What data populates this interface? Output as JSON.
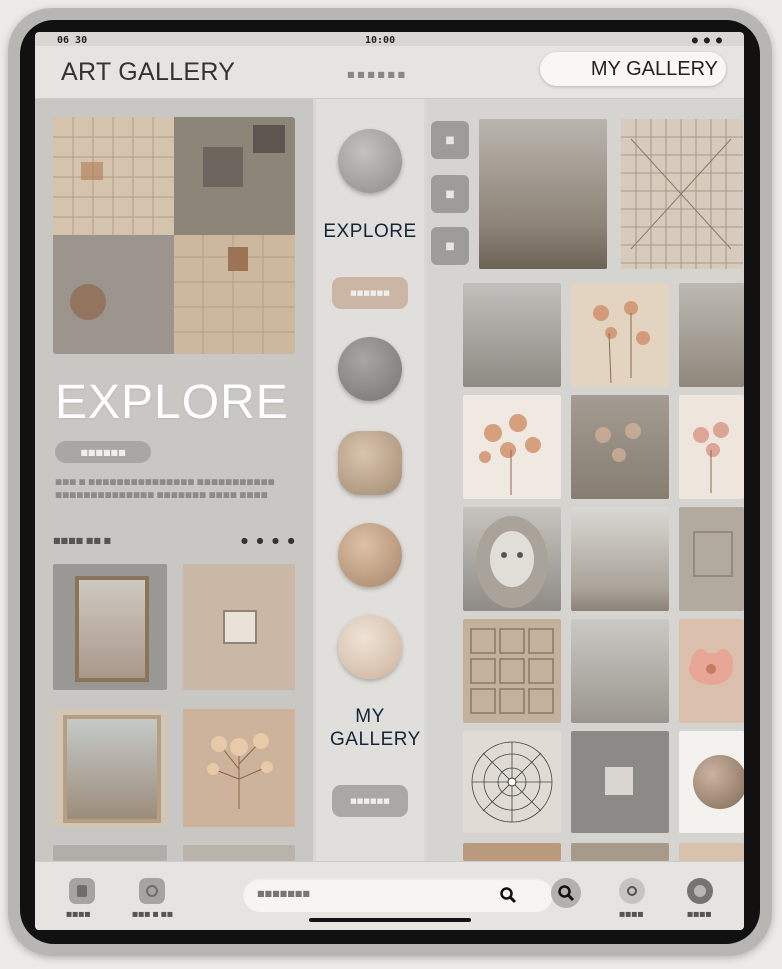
{
  "status": {
    "left": "06 30",
    "time": "10:00",
    "right": "● ● ●"
  },
  "header": {
    "title": "ART GALLERY",
    "center_text": "■ ■ ■   ■ ■ ■",
    "my_gallery_button": "MY GALLERY"
  },
  "left_panel": {
    "heading": "EXPLORE",
    "pill_label": "■■■■■■",
    "description": "■■■ ■ ■■■■■■■■■■■■■■■ ■■■■■■■■■■■ ■■■■■■■■■■■■■■ ■■■■■■■ ■■■■ ■■■■",
    "sub_label": "■■■■ ■■ ■",
    "dots": "● ● ● ●"
  },
  "center_column": {
    "explore_label": "EXPLORE",
    "my_gallery_label": "MY GALLERY",
    "pill_top": "■■■■■■",
    "pill_bottom": "■■■■■■"
  },
  "right_panel": {
    "icon_buttons": [
      "■",
      "■",
      "■"
    ]
  },
  "bottom_bar": {
    "nav_items": [
      {
        "label": "■■■■",
        "icon": "home-icon"
      },
      {
        "label": "■■■ ■ ■■",
        "icon": "gallery-icon"
      },
      {
        "label": "■■■■",
        "icon": "profile-icon"
      },
      {
        "label": "■■■■",
        "icon": "settings-icon"
      }
    ],
    "search_placeholder": "■■■■■■■"
  },
  "colors": {
    "accent_navy": "#14253a",
    "beige": "#c9b09b",
    "background": "#d9d7d3"
  }
}
